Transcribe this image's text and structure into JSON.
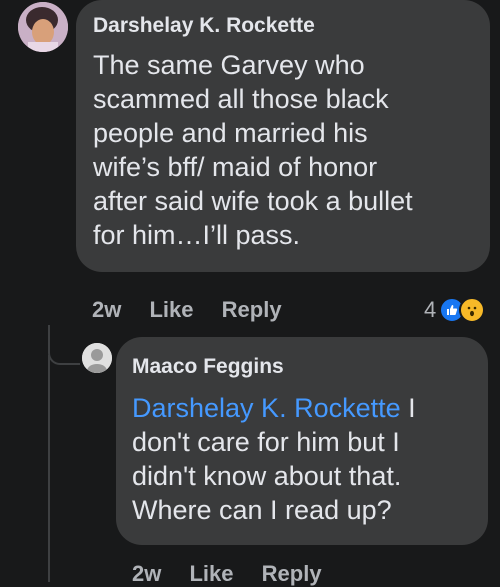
{
  "comments": [
    {
      "author": "Darshelay K. Rockette",
      "text": "The same Garvey who\nscammed all those black\npeople and married his\nwife’s bff/ maid of honor\nafter said wife took a bullet\nfor him…I’ll pass.",
      "time": "2w",
      "like_label": "Like",
      "reply_label": "Reply",
      "reaction_count": "4",
      "reaction_icons": [
        "like-icon",
        "wow-icon"
      ]
    },
    {
      "author": "Maaco Feggins",
      "mention": "Darshelay K. Rockette",
      "text": " I\ndon't care for him but I\ndidn't know about that.\nWhere can I read up?",
      "time": "2w",
      "like_label": "Like",
      "reply_label": "Reply"
    }
  ],
  "colors": {
    "background": "#18191a",
    "bubble": "#3a3b3c",
    "text": "#e4e6eb",
    "meta": "#b0b3b8",
    "mention": "#4599ff"
  }
}
